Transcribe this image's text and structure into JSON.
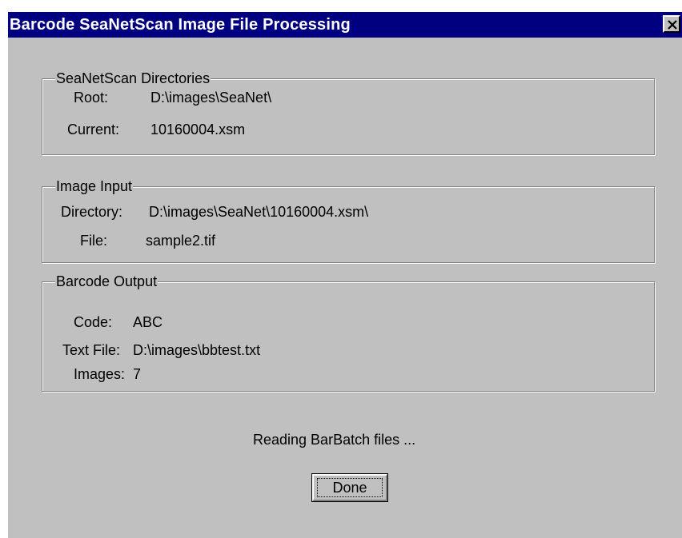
{
  "window": {
    "title": "Barcode SeaNetScan Image File Processing"
  },
  "directories": {
    "legend": "SeaNetScan Directories",
    "root_label": "Root:",
    "root_value": "D:\\images\\SeaNet\\",
    "current_label": "Current:",
    "current_value": "10160004.xsm"
  },
  "image_input": {
    "legend": "Image Input",
    "directory_label": "Directory:",
    "directory_value": "D:\\images\\SeaNet\\10160004.xsm\\",
    "file_label": "File:",
    "file_value": "sample2.tif"
  },
  "barcode_output": {
    "legend": "Barcode Output",
    "code_label": "Code:",
    "code_value": "ABC",
    "text_file_label": "Text File:",
    "text_file_value": "D:\\images\\bbtest.txt",
    "images_label": "Images:",
    "images_value": "7"
  },
  "status": {
    "text": "Reading BarBatch files ..."
  },
  "buttons": {
    "done_label": "Done"
  },
  "icons": {
    "close": "close-icon"
  },
  "colors": {
    "titlebar": "#000080",
    "face": "#c0c0c0"
  }
}
